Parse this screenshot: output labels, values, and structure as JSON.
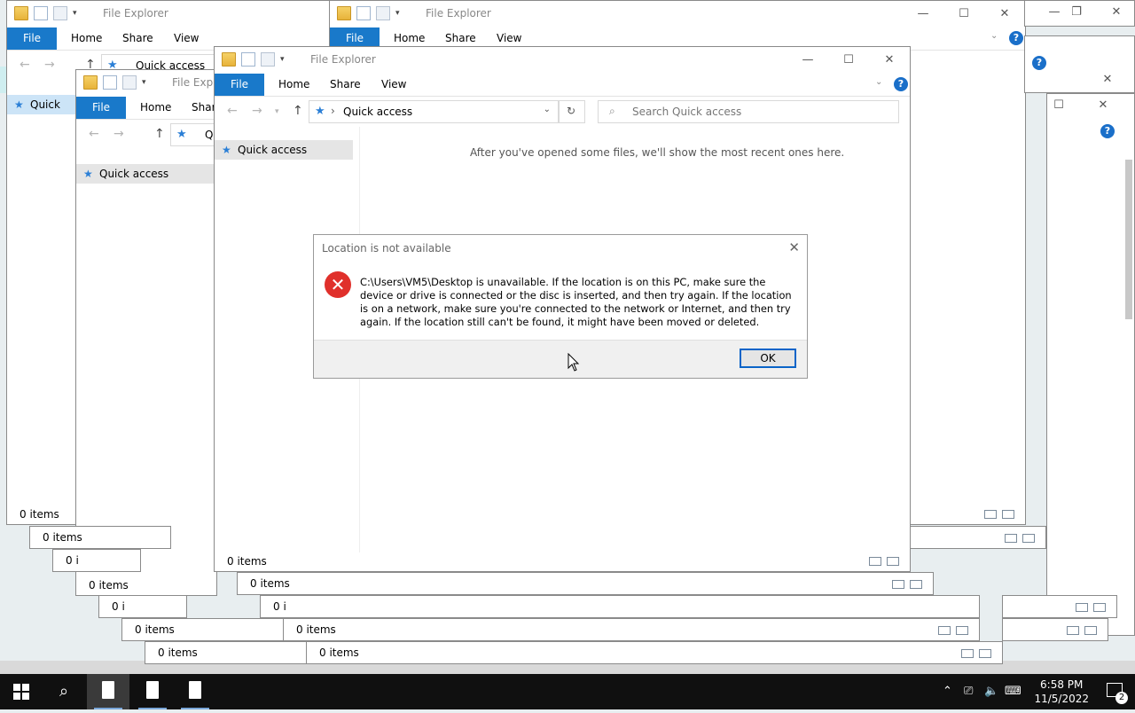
{
  "explorer": {
    "title": "File Explorer",
    "title_truncated": "File Explo",
    "tabs": {
      "file": "File",
      "home": "Home",
      "share": "Share",
      "view": "View"
    },
    "address_crumb": "Quick access",
    "address_crumb_truncated": "Q",
    "search_placeholder": "Search Quick access",
    "nav_item": "Quick access",
    "nav_item_truncated": "Quick",
    "empty_message": "After you've opened some files, we'll show the most recent ones here.",
    "status": "0 items",
    "status_truncated": "0 i",
    "help": "?"
  },
  "dialog": {
    "title": "Location is not available",
    "message": "C:\\Users\\VM5\\Desktop is unavailable. If the location is on this PC, make sure the device or drive is connected or the disc is inserted, and then try again. If the location is on a network, make sure you're connected to the network or Internet, and then try again. If the location still can't be found, it might have been moved or deleted.",
    "ok_label": "OK"
  },
  "taskbar": {
    "time": "6:58 PM",
    "date": "11/5/2022",
    "notification_count": "2"
  },
  "icons": {
    "start": "windows-logo-icon",
    "search": "search-icon",
    "error": "error-x-icon",
    "quick_access": "star-icon"
  },
  "colors": {
    "accent": "#1979ca",
    "error": "#e0302b",
    "taskbar": "#101010",
    "selection": "#cce4f7"
  }
}
